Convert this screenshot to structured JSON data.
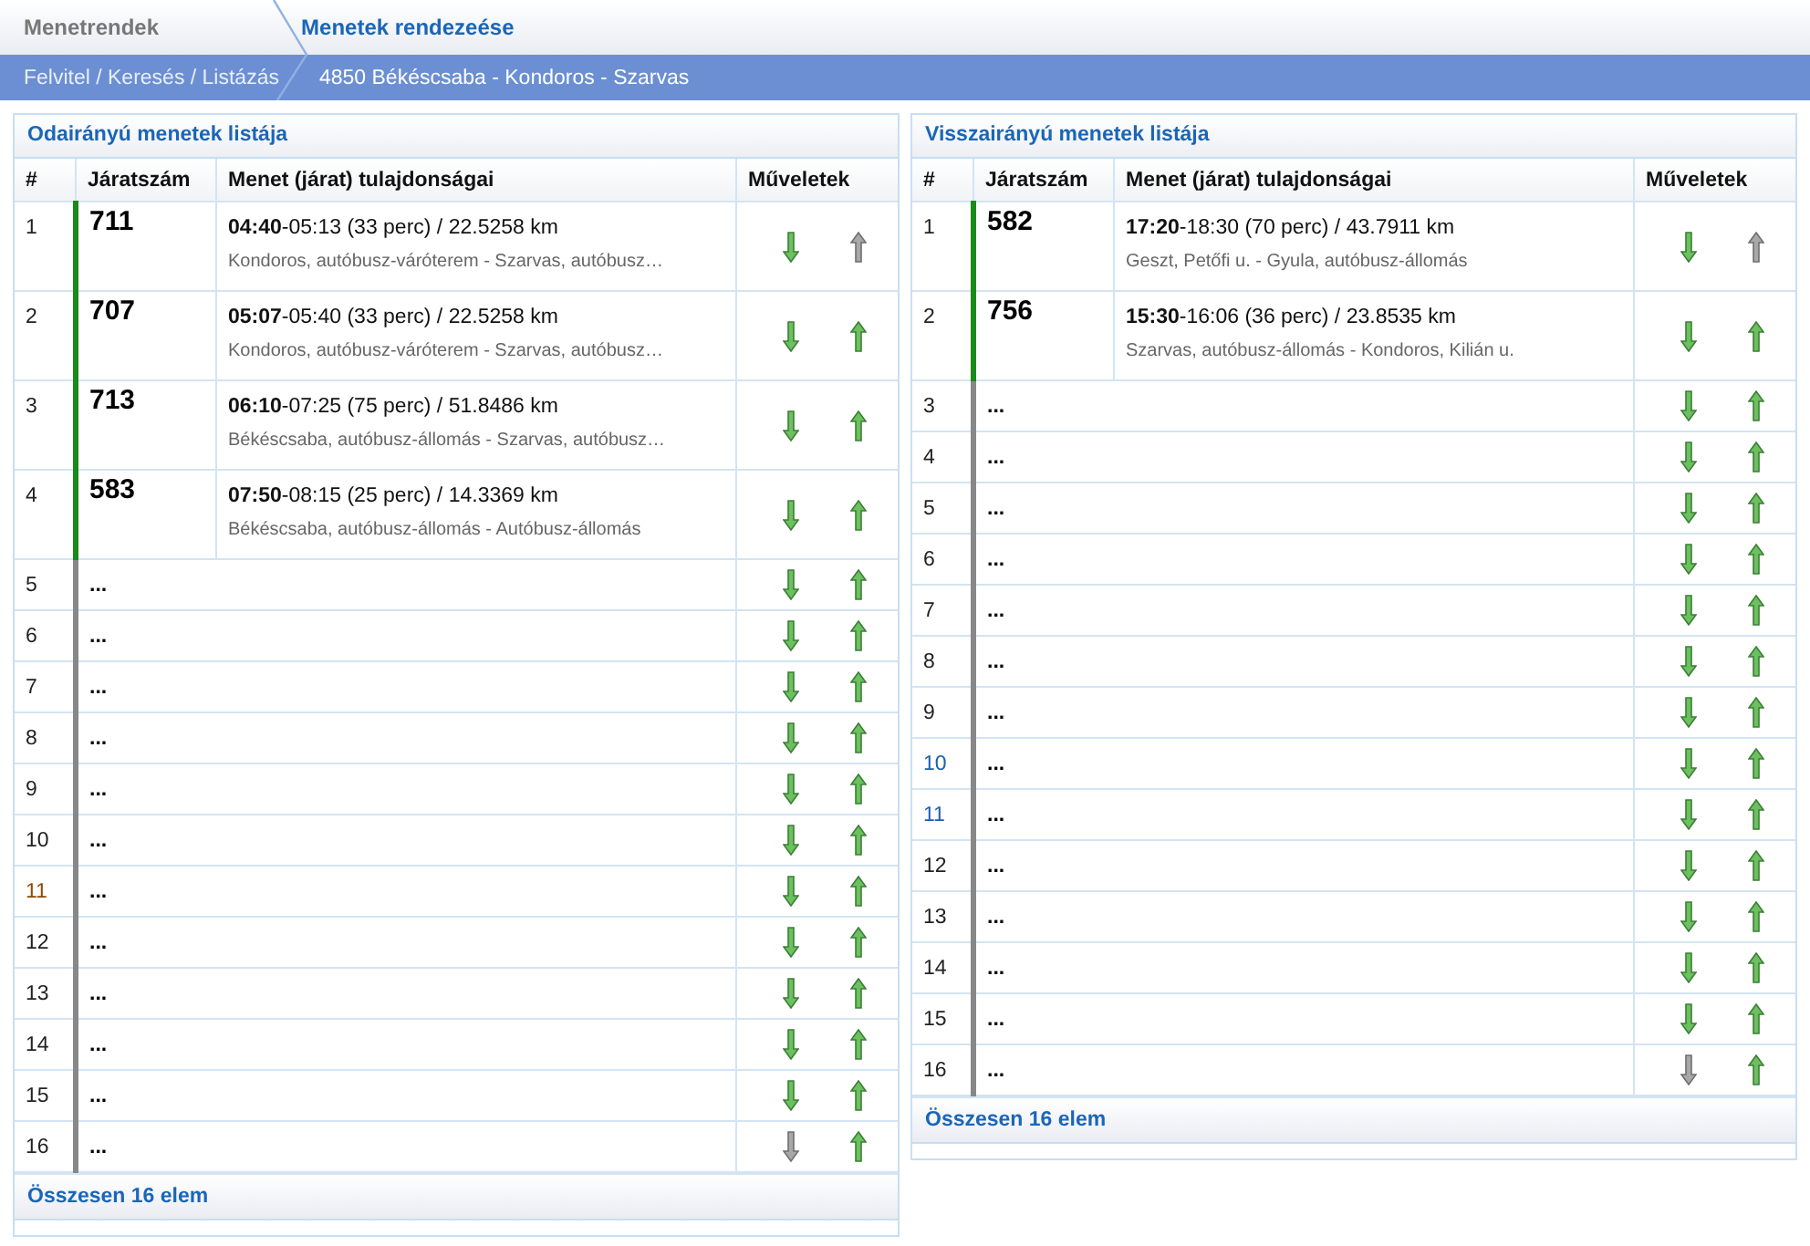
{
  "breadcrumb": {
    "tabs": [
      {
        "label": "Menetrendek",
        "selected": false
      },
      {
        "label": "Menetek rendezeése",
        "selected": true
      }
    ],
    "sub": [
      "Felvitel / Keresés / Listázás",
      "4850 Békéscsaba - Kondoros - Szarvas"
    ]
  },
  "panels": [
    {
      "title": "Odairányú menetek listája",
      "columns": [
        "#",
        "Járatszám",
        "Menet (járat) tulajdonságai",
        "Műveletek"
      ],
      "footer": "Összesen 16 elem",
      "rows": [
        {
          "kind": "trip",
          "index": "1",
          "color": "#222222",
          "number": "711",
          "time": "**04:40**-05:13 (33 perc) / 22.5258 km",
          "stops": "Kondoros, autóbusz-váróterem - Szarvas, autóbusz…",
          "down_enabled": true,
          "up_enabled": false
        },
        {
          "kind": "trip",
          "index": "2",
          "color": "#222222",
          "number": "707",
          "time": "**05:07**-05:40 (33 perc) / 22.5258 km",
          "stops": "Kondoros, autóbusz-váróterem - Szarvas, autóbusz…",
          "down_enabled": true,
          "up_enabled": true
        },
        {
          "kind": "trip",
          "index": "3",
          "color": "#222222",
          "number": "713",
          "time": "**06:10**-07:25 (75 perc) / 51.8486 km",
          "stops": "Békéscsaba, autóbusz-állomás - Szarvas, autóbusz…",
          "down_enabled": true,
          "up_enabled": true
        },
        {
          "kind": "trip",
          "index": "4",
          "color": "#222222",
          "number": "583",
          "time": "**07:50**-08:15 (25 perc) / 14.3369 km",
          "stops": "Békéscsaba, autóbusz-állomás - Autóbusz-állomás",
          "down_enabled": true,
          "up_enabled": true
        },
        {
          "kind": "placeholder",
          "index": "5",
          "color": "#222222",
          "text": "...",
          "down_enabled": true,
          "up_enabled": true
        },
        {
          "kind": "placeholder",
          "index": "6",
          "color": "#222222",
          "text": "...",
          "down_enabled": true,
          "up_enabled": true
        },
        {
          "kind": "placeholder",
          "index": "7",
          "color": "#222222",
          "text": "...",
          "down_enabled": true,
          "up_enabled": true
        },
        {
          "kind": "placeholder",
          "index": "8",
          "color": "#222222",
          "text": "...",
          "down_enabled": true,
          "up_enabled": true
        },
        {
          "kind": "placeholder",
          "index": "9",
          "color": "#222222",
          "text": "...",
          "down_enabled": true,
          "up_enabled": true
        },
        {
          "kind": "placeholder",
          "index": "10",
          "color": "#222222",
          "text": "...",
          "down_enabled": true,
          "up_enabled": true
        },
        {
          "kind": "placeholder",
          "index": "11",
          "color": "#8a4b08",
          "text": "...",
          "down_enabled": true,
          "up_enabled": true
        },
        {
          "kind": "placeholder",
          "index": "12",
          "color": "#222222",
          "text": "...",
          "down_enabled": true,
          "up_enabled": true
        },
        {
          "kind": "placeholder",
          "index": "13",
          "color": "#222222",
          "text": "...",
          "down_enabled": true,
          "up_enabled": true
        },
        {
          "kind": "placeholder",
          "index": "14",
          "color": "#222222",
          "text": "...",
          "down_enabled": true,
          "up_enabled": true
        },
        {
          "kind": "placeholder",
          "index": "15",
          "color": "#222222",
          "text": "...",
          "down_enabled": true,
          "up_enabled": true
        },
        {
          "kind": "placeholder",
          "index": "16",
          "color": "#222222",
          "text": "...",
          "down_enabled": false,
          "up_enabled": true
        }
      ]
    },
    {
      "title": "Visszairányú menetek listája",
      "columns": [
        "#",
        "Járatszám",
        "Menet (járat) tulajdonságai",
        "Műveletek"
      ],
      "footer": "Összesen 16 elem",
      "rows": [
        {
          "kind": "trip",
          "index": "1",
          "color": "#222222",
          "number": "582",
          "time": "**17:20**-18:30 (70 perc) / 43.7911 km",
          "stops": "Geszt, Petőfi u. - Gyula, autóbusz-állomás",
          "down_enabled": true,
          "up_enabled": false
        },
        {
          "kind": "trip",
          "index": "2",
          "color": "#222222",
          "number": "756",
          "time": "**15:30**-16:06 (36 perc) / 23.8535 km",
          "stops": "Szarvas, autóbusz-állomás - Kondoros, Kilián u.",
          "down_enabled": true,
          "up_enabled": true
        },
        {
          "kind": "placeholder",
          "index": "3",
          "color": "#222222",
          "text": "...",
          "down_enabled": true,
          "up_enabled": true
        },
        {
          "kind": "placeholder",
          "index": "4",
          "color": "#222222",
          "text": "...",
          "down_enabled": true,
          "up_enabled": true
        },
        {
          "kind": "placeholder",
          "index": "5",
          "color": "#222222",
          "text": "...",
          "down_enabled": true,
          "up_enabled": true
        },
        {
          "kind": "placeholder",
          "index": "6",
          "color": "#222222",
          "text": "...",
          "down_enabled": true,
          "up_enabled": true
        },
        {
          "kind": "placeholder",
          "index": "7",
          "color": "#222222",
          "text": "...",
          "down_enabled": true,
          "up_enabled": true
        },
        {
          "kind": "placeholder",
          "index": "8",
          "color": "#222222",
          "text": "...",
          "down_enabled": true,
          "up_enabled": true
        },
        {
          "kind": "placeholder",
          "index": "9",
          "color": "#222222",
          "text": "...",
          "down_enabled": true,
          "up_enabled": true
        },
        {
          "kind": "placeholder",
          "index": "10",
          "color": "#1a5fb4",
          "text": "...",
          "down_enabled": true,
          "up_enabled": true
        },
        {
          "kind": "placeholder",
          "index": "11",
          "color": "#1a5fb4",
          "text": "...",
          "down_enabled": true,
          "up_enabled": true
        },
        {
          "kind": "placeholder",
          "index": "12",
          "color": "#222222",
          "text": "...",
          "down_enabled": true,
          "up_enabled": true
        },
        {
          "kind": "placeholder",
          "index": "13",
          "color": "#222222",
          "text": "...",
          "down_enabled": true,
          "up_enabled": true
        },
        {
          "kind": "placeholder",
          "index": "14",
          "color": "#222222",
          "text": "...",
          "down_enabled": true,
          "up_enabled": true
        },
        {
          "kind": "placeholder",
          "index": "15",
          "color": "#222222",
          "text": "...",
          "down_enabled": true,
          "up_enabled": true
        },
        {
          "kind": "placeholder",
          "index": "16",
          "color": "#222222",
          "text": "...",
          "down_enabled": false,
          "up_enabled": true
        }
      ]
    }
  ]
}
